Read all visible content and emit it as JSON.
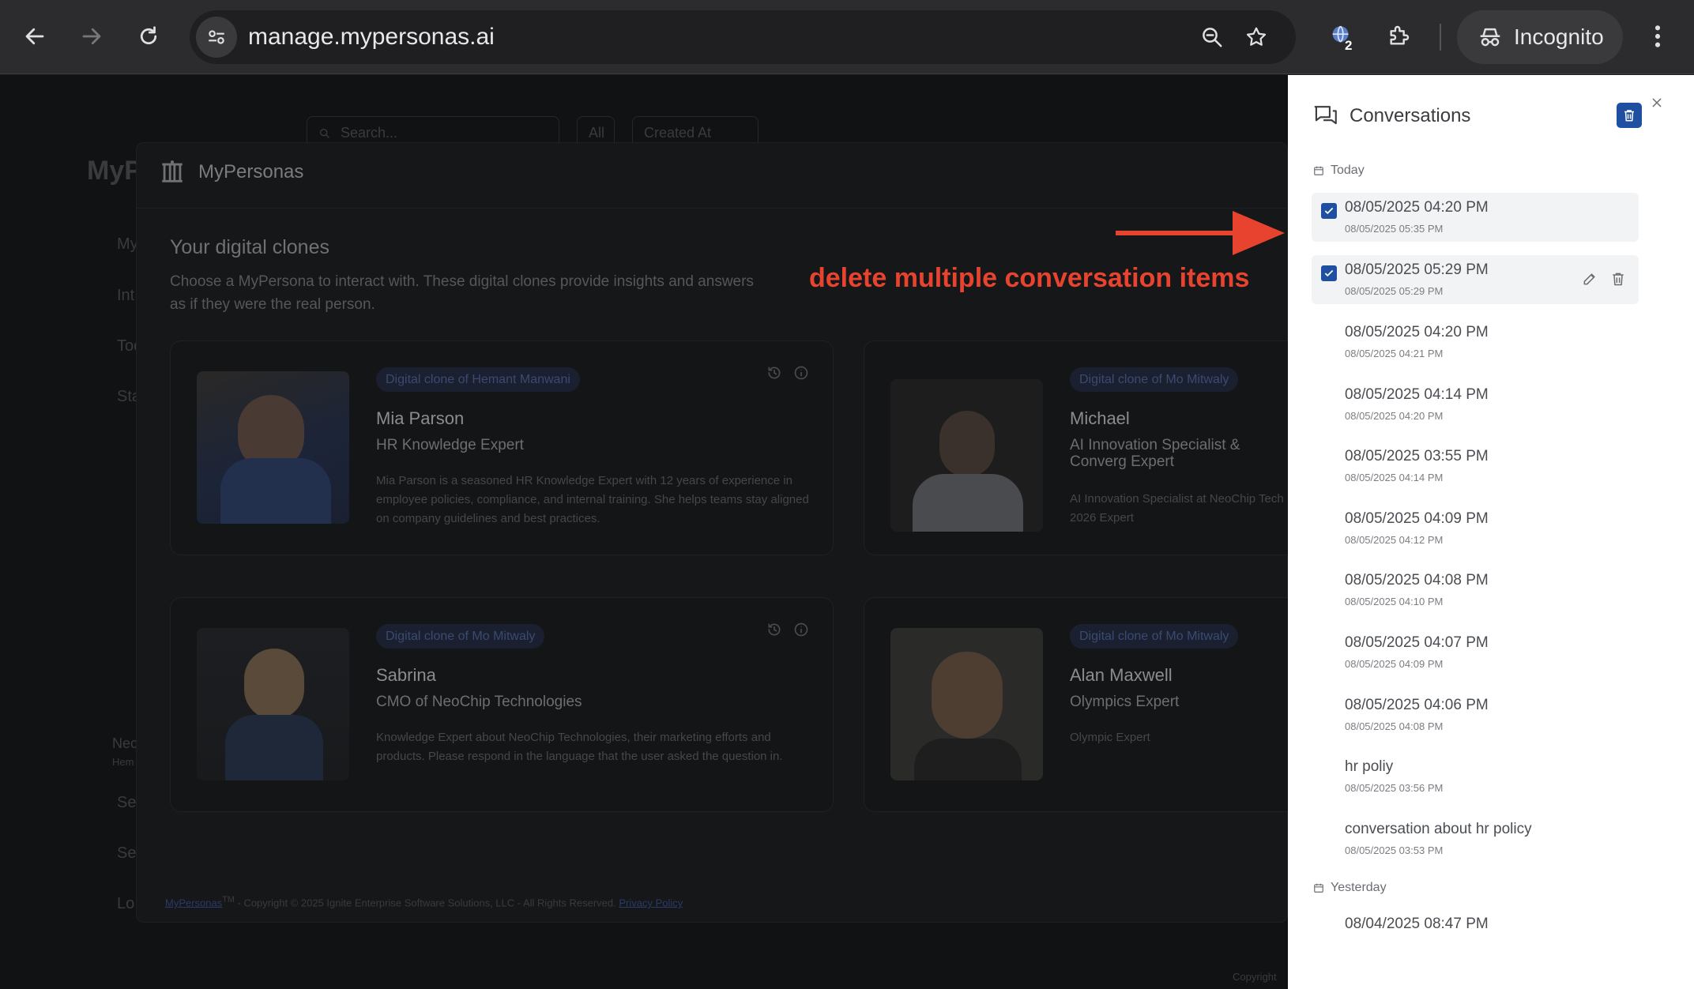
{
  "browser": {
    "url": "manage.mypersonas.ai",
    "incognito_label": "Incognito",
    "extension_badge": "2"
  },
  "background": {
    "search_placeholder": "Search...",
    "filter_value": "All",
    "sort_value": "Created At",
    "brand_partial": "MyP",
    "nav_partial": [
      "My",
      "Int",
      "Too",
      "Sta"
    ],
    "bottom_partial": [
      "Nec",
      "Hem",
      "Se",
      "Se",
      "Lo"
    ],
    "copyright_partial": "Copyright"
  },
  "modal": {
    "logo_text": "MyPersonas",
    "heading": "Your digital clones",
    "subheading": "Choose a MyPersona to interact with. These digital clones provide insights and answers as if they were the real person.",
    "cards": [
      {
        "tag": "Digital clone of Hemant Manwani",
        "name": "Mia Parson",
        "role": "HR Knowledge Expert",
        "desc": "Mia Parson is a seasoned HR Knowledge Expert with 12 years of experience in employee policies, compliance, and internal training. She helps teams stay aligned on company guidelines and best practices."
      },
      {
        "tag": "Digital clone of Mo Mitwaly",
        "name": "Michael",
        "role": "AI Innovation Specialist & Converg Expert",
        "desc": "AI Innovation Specialist at NeoChip Tech 2026 Expert"
      },
      {
        "tag": "Digital clone of Mo Mitwaly",
        "name": "Sabrina",
        "role": "CMO of NeoChip Technologies",
        "desc": "Knowledge Expert about NeoChip Technologies, their marketing efforts and products. Please respond in the language that the user asked the question in."
      },
      {
        "tag": "Digital clone of Mo Mitwaly",
        "name": "Alan Maxwell",
        "role": "Olympics Expert",
        "desc": "Olympic Expert"
      }
    ],
    "footer_brand": "MyPersonas",
    "footer_tm": "TM",
    "footer_text": " - Copyright © 2025 Ignite Enterprise Software Solutions, LLC - All Rights Reserved. ",
    "footer_link": "Privacy Policy"
  },
  "annotation": {
    "text": "delete multiple conversation items",
    "color": "#e8432e"
  },
  "drawer": {
    "title": "Conversations",
    "accent": "#1f4fa0",
    "today_label": "Today",
    "yesterday_label": "Yesterday",
    "today_items": [
      {
        "title": "08/05/2025 04:20 PM",
        "sub": "08/05/2025 05:35 PM",
        "checked": true
      },
      {
        "title": "08/05/2025 05:29 PM",
        "sub": "08/05/2025 05:29 PM",
        "checked": true
      },
      {
        "title": "08/05/2025 04:20 PM",
        "sub": "08/05/2025 04:21 PM",
        "checked": false
      },
      {
        "title": "08/05/2025 04:14 PM",
        "sub": "08/05/2025 04:20 PM",
        "checked": false
      },
      {
        "title": "08/05/2025 03:55 PM",
        "sub": "08/05/2025 04:14 PM",
        "checked": false
      },
      {
        "title": "08/05/2025 04:09 PM",
        "sub": "08/05/2025 04:12 PM",
        "checked": false
      },
      {
        "title": "08/05/2025 04:08 PM",
        "sub": "08/05/2025 04:10 PM",
        "checked": false
      },
      {
        "title": "08/05/2025 04:07 PM",
        "sub": "08/05/2025 04:09 PM",
        "checked": false
      },
      {
        "title": "08/05/2025 04:06 PM",
        "sub": "08/05/2025 04:08 PM",
        "checked": false
      },
      {
        "title": "hr poliy",
        "sub": "08/05/2025 03:56 PM",
        "checked": false
      },
      {
        "title": "conversation about hr policy",
        "sub": "08/05/2025 03:53 PM",
        "checked": false
      }
    ],
    "yesterday_items": [
      {
        "title": "08/04/2025 08:47 PM"
      }
    ]
  }
}
